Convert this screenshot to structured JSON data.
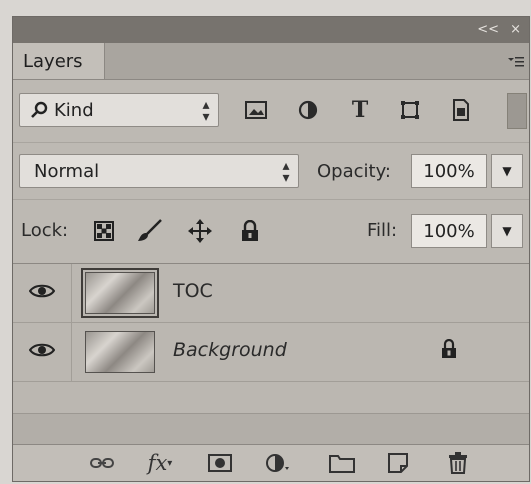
{
  "panel": {
    "tab_label": "Layers",
    "title_controls": [
      "<<",
      "×"
    ],
    "menu_icon": "panel-menu-icon"
  },
  "filter": {
    "kind_label": "Kind",
    "icons": [
      "image-filter-icon",
      "adjustment-filter-icon",
      "type-filter-icon",
      "shape-filter-icon",
      "smart-object-filter-icon"
    ]
  },
  "blend": {
    "mode": "Normal",
    "opacity_label": "Opacity:",
    "opacity_value": "100%"
  },
  "lock": {
    "label": "Lock:",
    "icons": [
      "lock-transparent-pixels-icon",
      "lock-image-pixels-icon",
      "lock-position-icon",
      "lock-all-icon"
    ],
    "fill_label": "Fill:",
    "fill_value": "100%"
  },
  "layers": [
    {
      "name": "TOC",
      "visible": true,
      "selected": true,
      "locked": false
    },
    {
      "name": "Background",
      "visible": true,
      "selected": false,
      "locked": true
    }
  ],
  "footer": {
    "icons": [
      "link-layers-icon",
      "add-layer-style-icon",
      "add-mask-icon",
      "new-adjustment-layer-icon",
      "new-group-icon",
      "new-layer-icon",
      "delete-layer-icon"
    ],
    "fx_label": "fx"
  }
}
